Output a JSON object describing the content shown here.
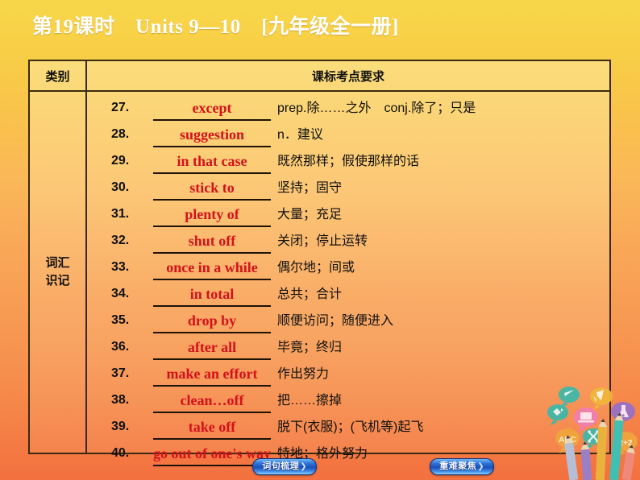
{
  "header": {
    "title": "第19课时　Units 9—10　[九年级全一册]"
  },
  "table": {
    "columns": {
      "category": "类别",
      "requirement": "课标考点要求"
    },
    "category_label_line1": "词汇",
    "category_label_line2": "识记",
    "rows": [
      {
        "num": "27.",
        "word": "except",
        "meaning": "prep.除……之外　conj.除了；只是"
      },
      {
        "num": "28.",
        "word": "suggestion",
        "meaning": "n．建议"
      },
      {
        "num": "29.",
        "word": "in that case",
        "meaning": "既然那样；假使那样的话"
      },
      {
        "num": "30.",
        "word": "stick to",
        "meaning": "坚持；固守"
      },
      {
        "num": "31.",
        "word": "plenty of",
        "meaning": "大量；充足"
      },
      {
        "num": "32.",
        "word": "shut off",
        "meaning": "关闭；停止运转"
      },
      {
        "num": "33.",
        "word": "once in a while",
        "meaning": "偶尔地；间或"
      },
      {
        "num": "34.",
        "word": "in total",
        "meaning": "总共；合计"
      },
      {
        "num": "35.",
        "word": "drop by",
        "meaning": "顺便访问；随便进入"
      },
      {
        "num": "36.",
        "word": "after all",
        "meaning": "毕竟；终归"
      },
      {
        "num": "37.",
        "word": "make an effort",
        "meaning": "作出努力"
      },
      {
        "num": "38.",
        "word": "clean…off",
        "meaning": "把……擦掉"
      },
      {
        "num": "39.",
        "word": "take off",
        "meaning": "脱下(衣服)；(飞机等)起飞"
      },
      {
        "num": "40.",
        "word": "go out of one's way",
        "meaning": "特地；格外努力"
      }
    ]
  },
  "footer": {
    "left_button": "词句梳理",
    "right_button": "重难聚焦",
    "arrow_glyph": "❯"
  },
  "colors": {
    "word_red": "#d4111b",
    "ink": "#111111",
    "border": "#3b2a10",
    "bg_top": "#f7d74a",
    "bg_bottom": "#f3713f",
    "button_blue": "#1b4fb8"
  }
}
